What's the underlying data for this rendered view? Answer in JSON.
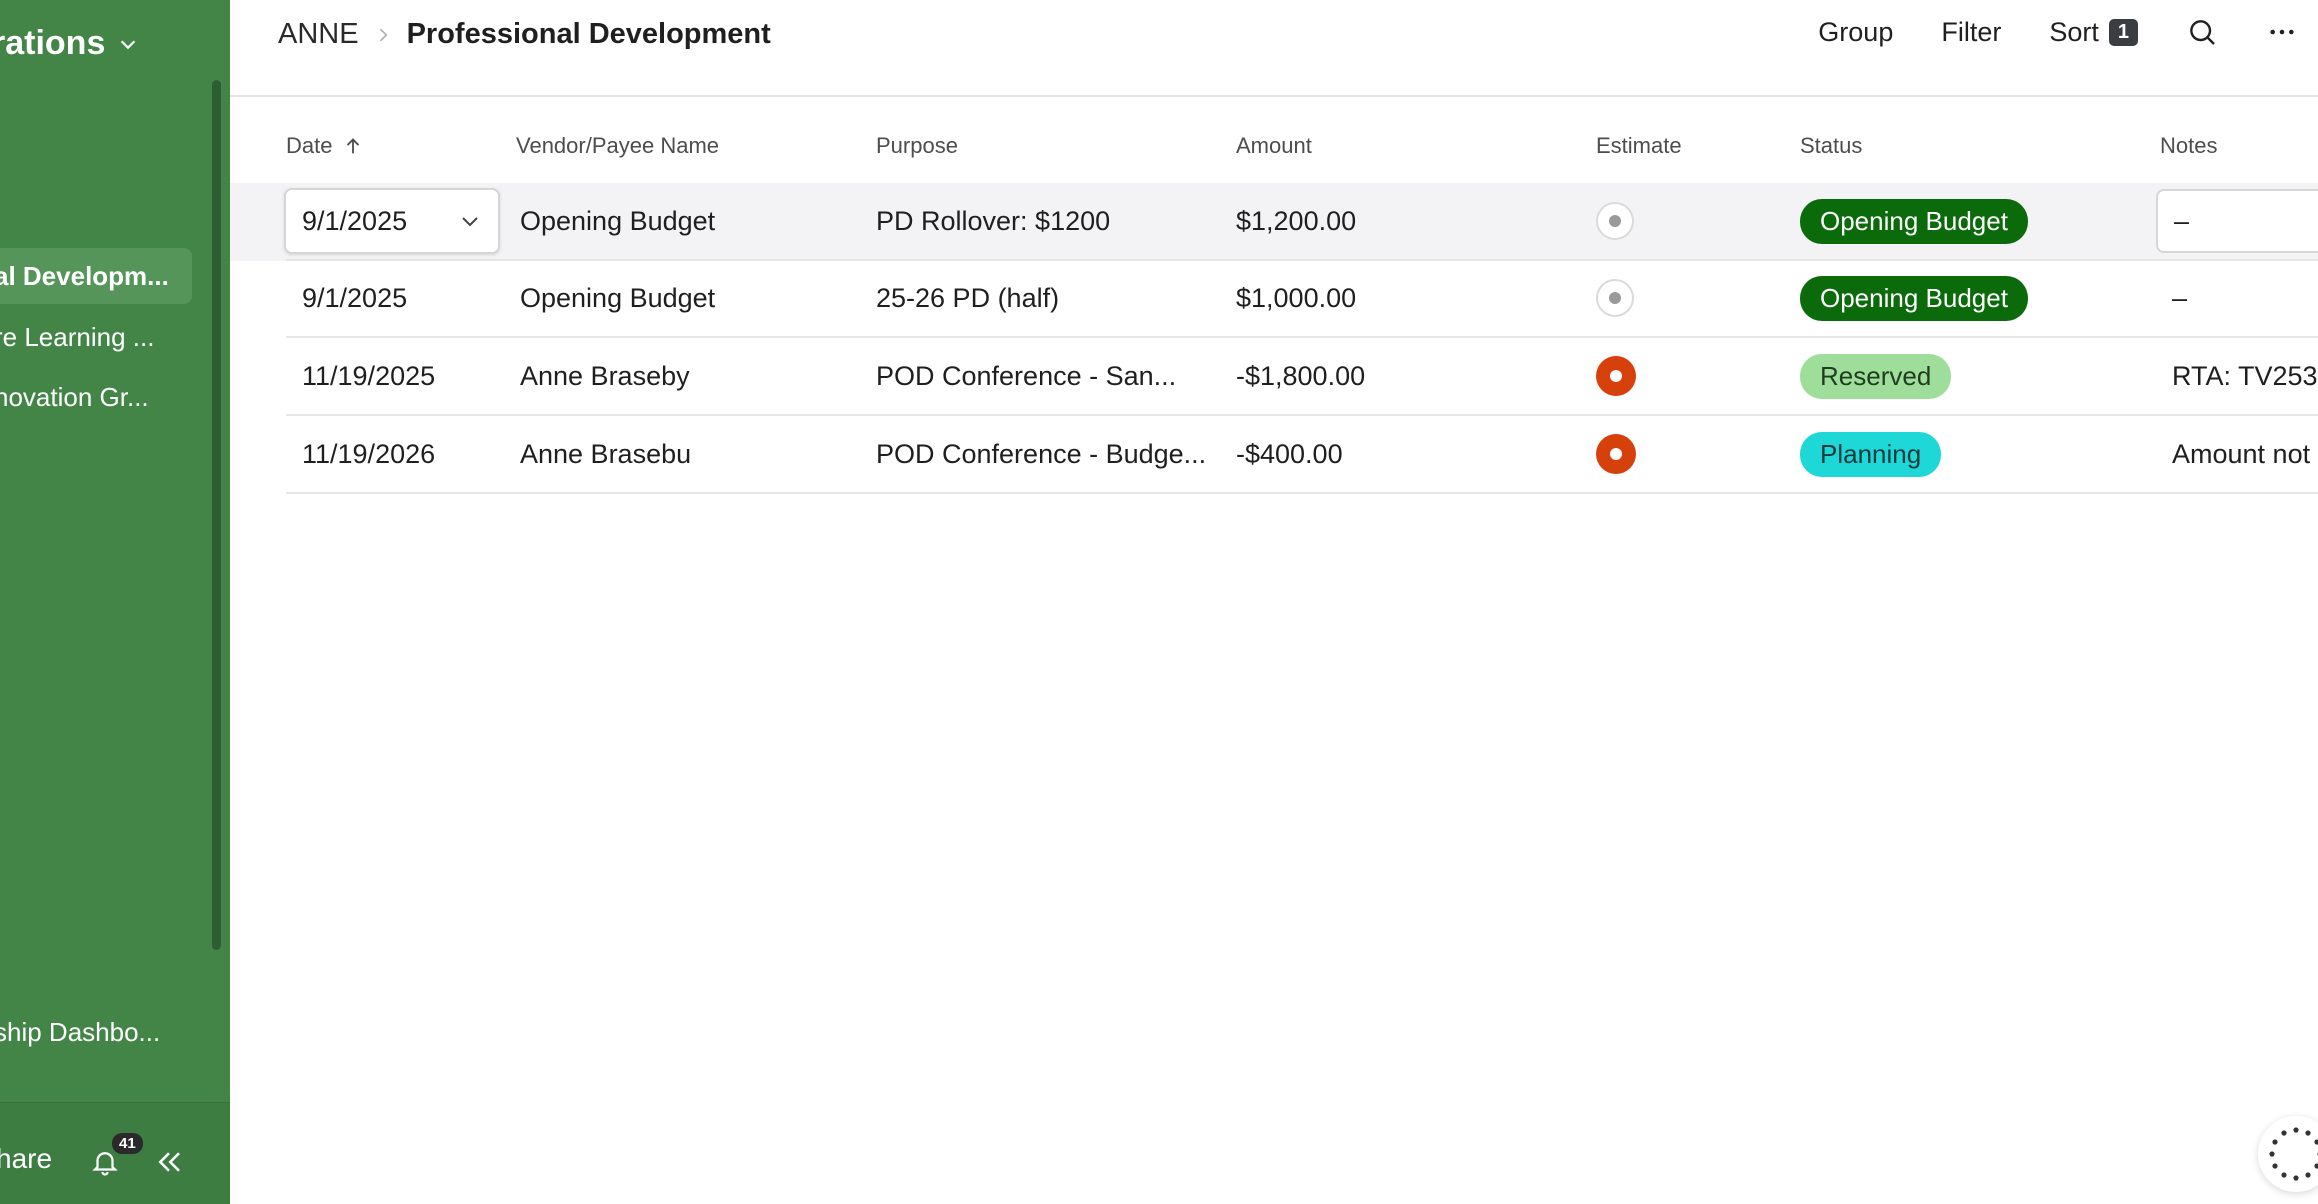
{
  "sidebar": {
    "workspace_title": "rations",
    "items": [
      {
        "label": "al Developm...",
        "active": true
      },
      {
        "label": "re Learning ...",
        "active": false
      },
      {
        "label": "novation Gr...",
        "active": false
      },
      {
        "label": "ship Dashbo...",
        "active": false
      }
    ],
    "share_label": "hare",
    "notification_count": "41",
    "background_color": "#438547"
  },
  "breadcrumb": {
    "root": "ANNE",
    "current": "Professional Development"
  },
  "toolbar": {
    "group_label": "Group",
    "filter_label": "Filter",
    "sort_label": "Sort",
    "sort_count": "1"
  },
  "table": {
    "columns": [
      {
        "key": "date",
        "label": "Date",
        "sorted": "ascending"
      },
      {
        "key": "vendor",
        "label": "Vendor/Payee Name"
      },
      {
        "key": "purpose",
        "label": "Purpose"
      },
      {
        "key": "amount",
        "label": "Amount"
      },
      {
        "key": "estimate",
        "label": "Estimate"
      },
      {
        "key": "status",
        "label": "Status"
      },
      {
        "key": "notes",
        "label": "Notes"
      }
    ],
    "rows": [
      {
        "date": "9/1/2025",
        "vendor": "Opening Budget",
        "purpose": "PD Rollover: $1200",
        "amount": "$1,200.00",
        "estimate": false,
        "status": "Opening Budget",
        "notes": "–",
        "selected": true
      },
      {
        "date": "9/1/2025",
        "vendor": "Opening Budget",
        "purpose": "25-26 PD (half)",
        "amount": "$1,000.00",
        "estimate": false,
        "status": "Opening Budget",
        "notes": "–",
        "selected": false
      },
      {
        "date": "11/19/2025",
        "vendor": "Anne Braseby",
        "purpose": "POD Conference - San...",
        "amount": "-$1,800.00",
        "estimate": true,
        "status": "Reserved",
        "notes": "RTA: TV253",
        "selected": false
      },
      {
        "date": "11/19/2026",
        "vendor": "Anne Brasebu",
        "purpose": "POD Conference - Budge...",
        "amount": "-$400.00",
        "estimate": true,
        "status": "Planning",
        "notes": "Amount not",
        "selected": false
      }
    ]
  },
  "status_colors": {
    "Opening Budget": {
      "bg": "#0b6b0b",
      "fg": "#ffffff"
    },
    "Reserved": {
      "bg": "#9fde9a",
      "fg": "#1f3d1f"
    },
    "Planning": {
      "bg": "#1ed8d8",
      "fg": "#0d3a3a"
    }
  },
  "estimate_color": "#d6400b"
}
